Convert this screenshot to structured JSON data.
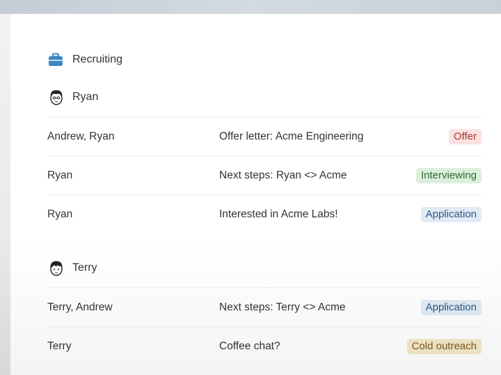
{
  "section": {
    "title": "Recruiting",
    "icon": "briefcase-icon"
  },
  "groups": [
    {
      "name": "Ryan",
      "avatar": "ryan-avatar",
      "rows": [
        {
          "people": "Andrew, Ryan",
          "subject": "Offer letter: Acme Engineering",
          "status": "Offer"
        },
        {
          "people": "Ryan",
          "subject": "Next steps: Ryan <> Acme",
          "status": "Interviewing"
        },
        {
          "people": "Ryan",
          "subject": "Interested in Acme Labs!",
          "status": "Application"
        }
      ]
    },
    {
      "name": "Terry",
      "avatar": "terry-avatar",
      "rows": [
        {
          "people": "Terry, Andrew",
          "subject": "Next steps: Terry <> Acme",
          "status": "Application"
        },
        {
          "people": "Terry",
          "subject": "Coffee chat?",
          "status": "Cold outreach"
        }
      ]
    }
  ],
  "status_colors": {
    "Offer": {
      "bg": "#fbe2e0",
      "fg": "#a33a33"
    },
    "Interviewing": {
      "bg": "#dcefdc",
      "fg": "#2e6b35"
    },
    "Application": {
      "bg": "#e1ebf6",
      "fg": "#2d5780"
    },
    "Cold outreach": {
      "bg": "#f4e8c8",
      "fg": "#7a5a18"
    }
  }
}
